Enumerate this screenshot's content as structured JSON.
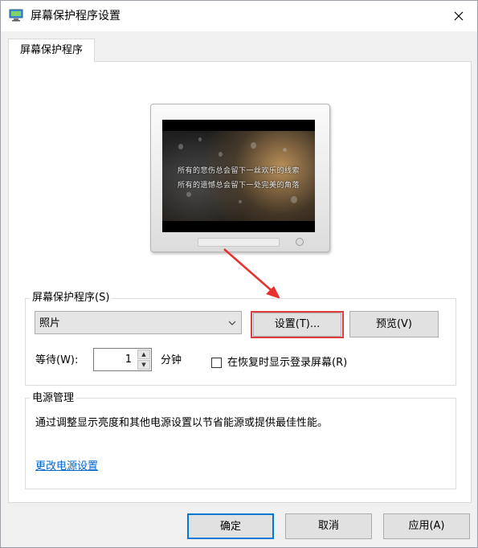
{
  "window": {
    "title": "屏幕保护程序设置",
    "close_glyph": "✕"
  },
  "tab": {
    "label": "屏幕保护程序"
  },
  "preview": {
    "lyric_line1": "所有的悲伤总会留下一丝欢乐的线索",
    "lyric_line2": "所有的遗憾总会留下一处完美的角落"
  },
  "screensaver": {
    "group_label": "屏幕保护程序(S)",
    "selected": "照片",
    "settings_button": "设置(T)...",
    "preview_button": "预览(V)",
    "wait_label": "等待(W):",
    "wait_value": "1",
    "wait_unit": "分钟",
    "resume_checkbox_label": "在恢复时显示登录屏幕(R)",
    "resume_checked": false
  },
  "power": {
    "group_label": "电源管理",
    "description": "通过调整显示亮度和其他电源设置以节省能源或提供最佳性能。",
    "link": "更改电源设置"
  },
  "footer": {
    "ok_button": "确定",
    "cancel_button": "取消",
    "apply_button": "应用(A)"
  },
  "colors": {
    "highlight_border": "#e03c3c",
    "arrow": "#e8312f",
    "link": "#0066cc",
    "default_button_border": "#0078d7"
  }
}
